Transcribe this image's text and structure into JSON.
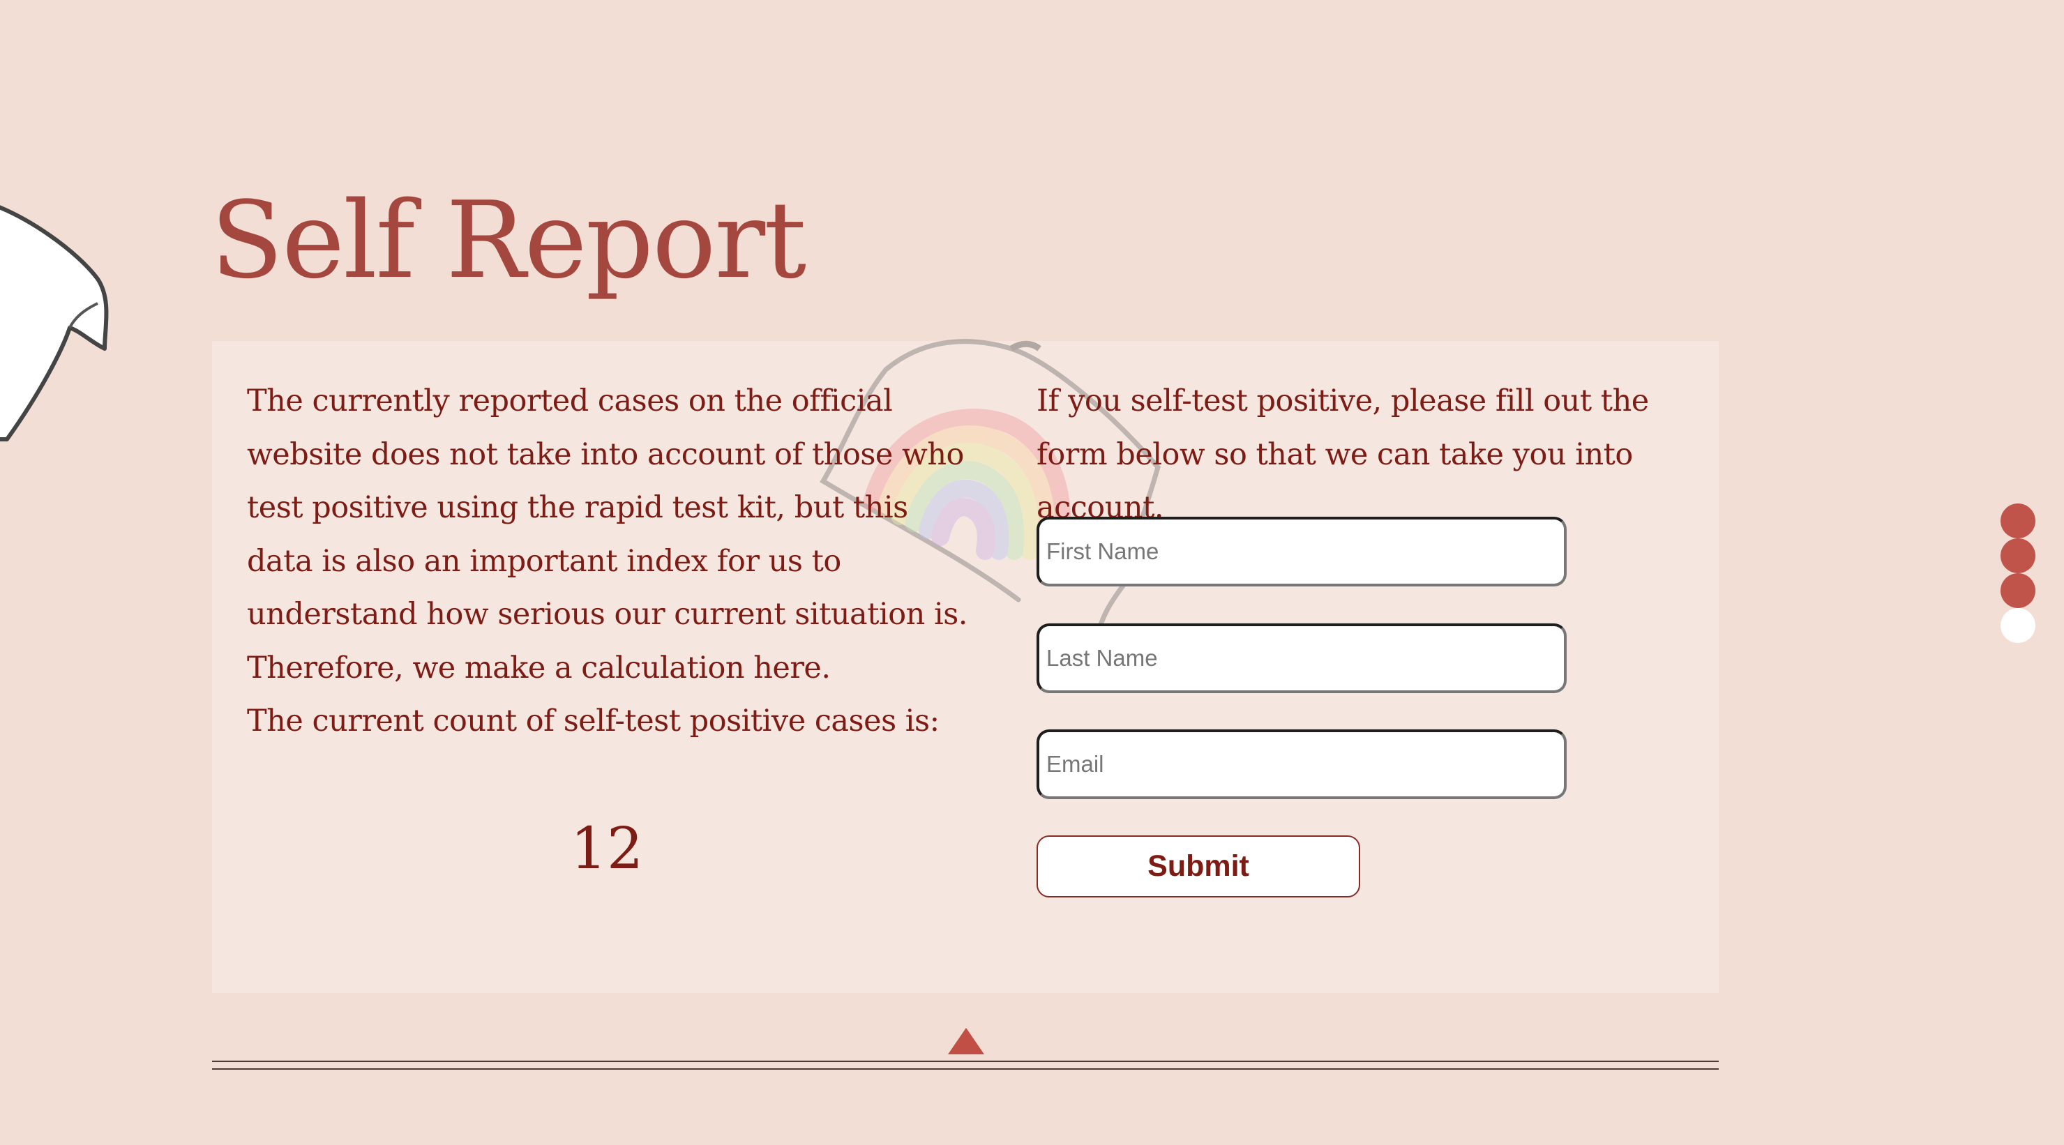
{
  "page": {
    "title": "Self Report"
  },
  "info": {
    "paragraph": "The currently reported cases on the official website does not take into account of those who test positive using the rapid test kit, but this data is also an important index for us to understand how serious our current situation is. Therefore, we make a calculation here.",
    "count_label": "The current count of self-test positive cases is:",
    "count_value": "12"
  },
  "form": {
    "intro": "If you self-test positive, please fill out the form below so that we can take you into account.",
    "first_name": {
      "placeholder": "First Name",
      "value": ""
    },
    "last_name": {
      "placeholder": "Last Name",
      "value": ""
    },
    "email": {
      "placeholder": "Email",
      "value": ""
    },
    "submit_label": "Submit"
  },
  "navigation": {
    "page_dots": [
      {
        "active": false
      },
      {
        "active": false
      },
      {
        "active": false
      },
      {
        "active": true
      }
    ],
    "scroll_up_icon": "triangle-up-icon"
  },
  "colors": {
    "background": "#f3ded6",
    "title": "#a4473f",
    "text": "#7c1c15",
    "accent": "#c0534a",
    "active_dot": "#ffffff"
  }
}
